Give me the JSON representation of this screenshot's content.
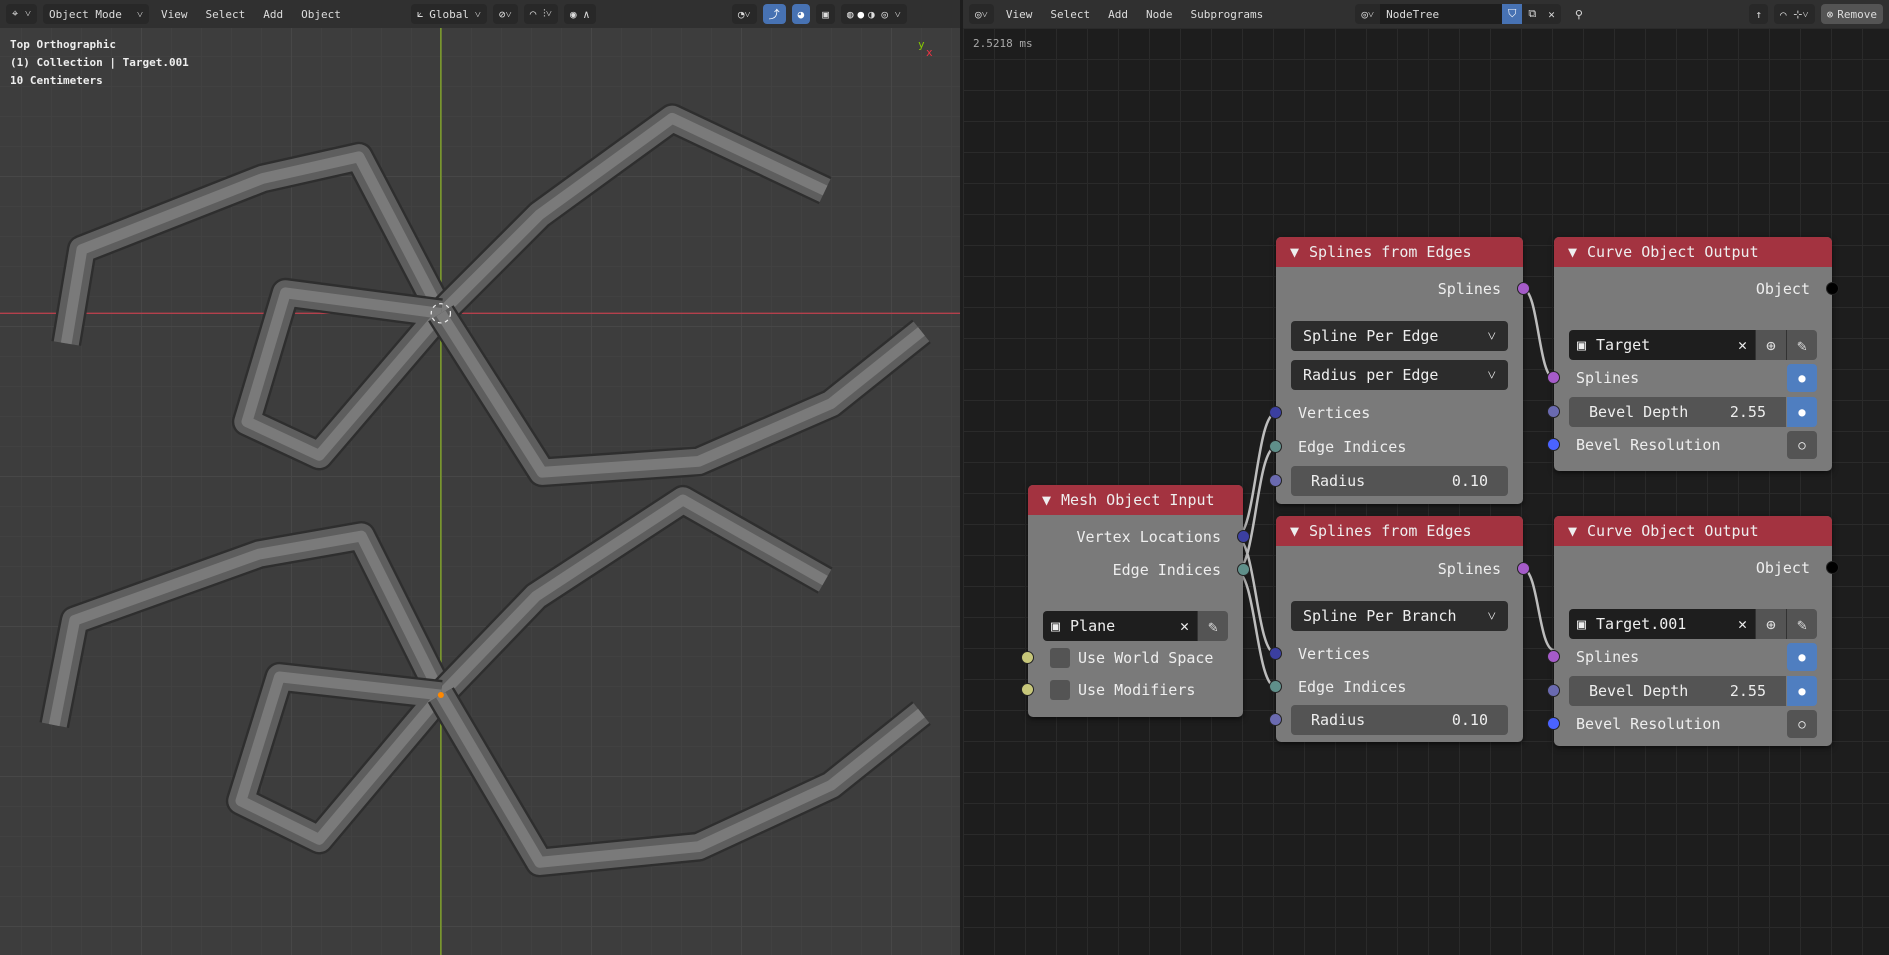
{
  "viewport": {
    "header": {
      "mode": "Object Mode",
      "menus": [
        "View",
        "Select",
        "Add",
        "Object"
      ],
      "orientation": "Global"
    },
    "overlay": {
      "view": "Top Orthographic",
      "collection": "(1) Collection | Target.001",
      "scale": "10 Centimeters"
    },
    "axis": {
      "y": "y",
      "x": "x"
    }
  },
  "node_editor": {
    "header": {
      "menus": [
        "View",
        "Select",
        "Add",
        "Node",
        "Subprograms"
      ],
      "tree_name": "NodeTree",
      "remove": "Remove"
    },
    "timing": "2.5218 ms",
    "nodes": {
      "mesh_input": {
        "title": "Mesh Object Input",
        "outputs": [
          "Vertex Locations",
          "Edge Indices"
        ],
        "object": "Plane",
        "use_world_space": "Use World Space",
        "use_modifiers": "Use Modifiers"
      },
      "splines1": {
        "title": "Splines from Edges",
        "output": "Splines",
        "mode": "Spline Per Edge",
        "radius_mode": "Radius per Edge",
        "vertices": "Vertices",
        "edge_indices": "Edge Indices",
        "radius_label": "Radius",
        "radius": "0.10"
      },
      "splines2": {
        "title": "Splines from Edges",
        "output": "Splines",
        "mode": "Spline Per Branch",
        "vertices": "Vertices",
        "edge_indices": "Edge Indices",
        "radius_label": "Radius",
        "radius": "0.10"
      },
      "out1": {
        "title": "Curve Object Output",
        "output": "Object",
        "target": "Target",
        "splines": "Splines",
        "bevel_depth_label": "Bevel Depth",
        "bevel_depth": "2.55",
        "bevel_resolution": "Bevel Resolution"
      },
      "out2": {
        "title": "Curve Object Output",
        "output": "Object",
        "target": "Target.001",
        "splines": "Splines",
        "bevel_depth_label": "Bevel Depth",
        "bevel_depth": "2.55",
        "bevel_resolution": "Bevel Resolution"
      }
    }
  },
  "colors": {
    "node_header": "#a33340",
    "spline_socket": "#a55bc9",
    "vector_socket": "#3b3fa0",
    "int_socket": "#5f8f8a",
    "float_socket": "#6a6ab0",
    "object_socket": "#000000",
    "bool_socket": "#c7c77a",
    "accent": "#4772b3"
  }
}
